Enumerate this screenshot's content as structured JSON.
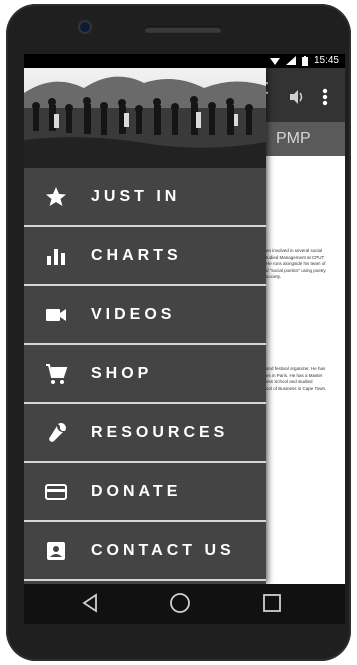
{
  "status": {
    "time": "15:45"
  },
  "appbar": {
    "title_visible": "t"
  },
  "tabs": {
    "visible_tab": "PMP",
    "scroll_arrow": "‹"
  },
  "drawer": {
    "items": [
      {
        "label": "JUST IN",
        "icon": "star-icon"
      },
      {
        "label": "CHARTS",
        "icon": "bar-chart-icon"
      },
      {
        "label": "VIDEOS",
        "icon": "video-camera-icon"
      },
      {
        "label": "SHOP",
        "icon": "shopping-cart-icon"
      },
      {
        "label": "RESOURCES",
        "icon": "wrench-icon"
      },
      {
        "label": "DONATE",
        "icon": "credit-card-icon"
      },
      {
        "label": "CONTACT US",
        "icon": "contact-card-icon"
      }
    ]
  },
  "content": {
    "para1": [
      "en involved in several social",
      "tudied Management at CPUT",
      "He runs alongside his team of",
      "d \"social poetics\" using poetry",
      "society."
    ],
    "para2": [
      "and festival organizer. He has",
      "es in Paris. He has a Master",
      "ess School and studied",
      "ool of Business in Cape Town."
    ]
  },
  "colors": {
    "drawer_bg": "#444444",
    "appbar_bg": "#333333",
    "divider": "#d6d6d6"
  }
}
